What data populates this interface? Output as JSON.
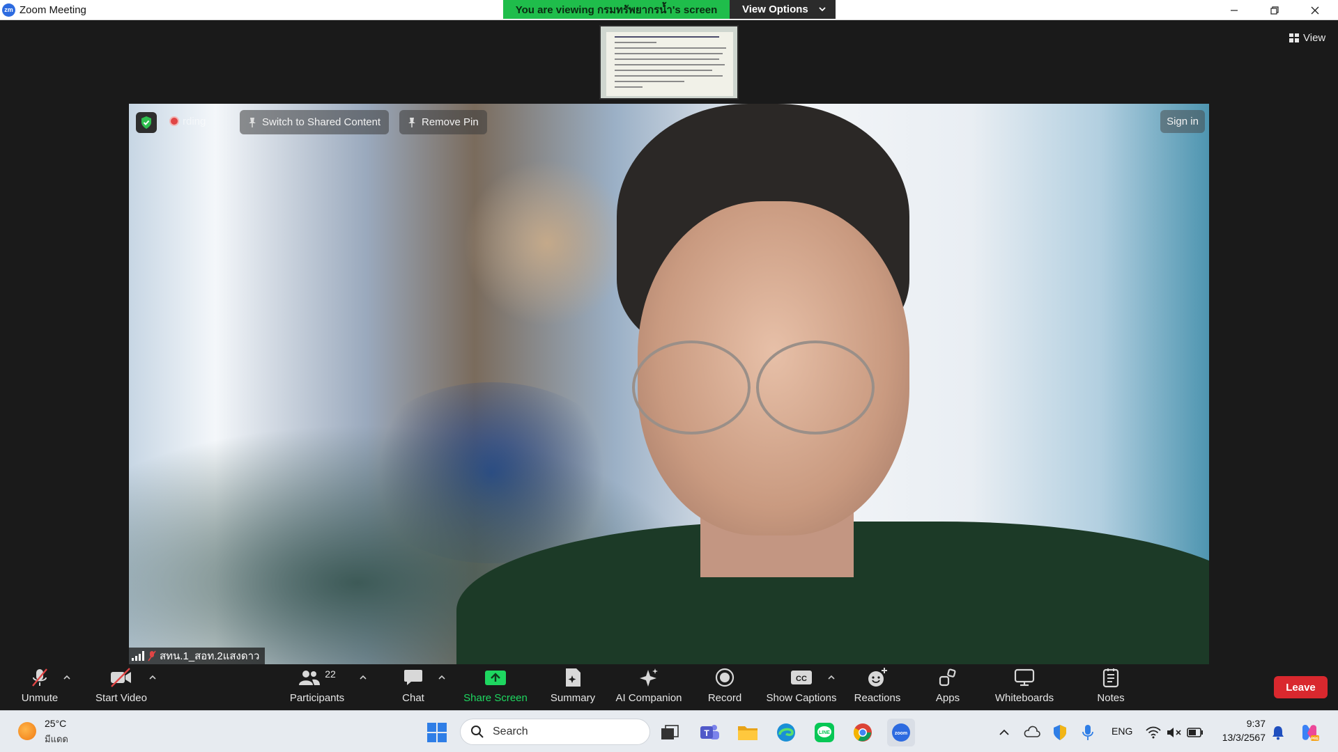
{
  "window": {
    "title": "Zoom Meeting",
    "logo_text": "zm"
  },
  "banner": {
    "viewing_text": "You are viewing กรมทรัพยากรน้ำ's screen",
    "view_options_label": "View Options"
  },
  "top_right": {
    "view_label": "View"
  },
  "video": {
    "recording_text": "rding",
    "switch_label": "Switch to Shared Content",
    "remove_pin_label": "Remove Pin",
    "sign_in_label": "Sign in",
    "participant_name": "สทน.1_สอท.2แสงดาว"
  },
  "toolbar": {
    "unmute": "Unmute",
    "start_video": "Start Video",
    "participants": "Participants",
    "participant_count": "22",
    "chat": "Chat",
    "share_screen": "Share Screen",
    "summary": "Summary",
    "ai_companion": "AI Companion",
    "record": "Record",
    "show_captions": "Show Captions",
    "reactions": "Reactions",
    "apps": "Apps",
    "whiteboards": "Whiteboards",
    "notes": "Notes",
    "leave": "Leave"
  },
  "taskbar": {
    "weather_temp": "25°C",
    "weather_condition": "มีแดด",
    "search_placeholder": "Search",
    "language": "ENG",
    "time": "9:37",
    "date": "13/3/2567"
  },
  "colors": {
    "share_green": "#1ed760",
    "banner_green": "#1fbd4b",
    "leave_red": "#d9282e",
    "accent_blue": "#2d6be0"
  }
}
